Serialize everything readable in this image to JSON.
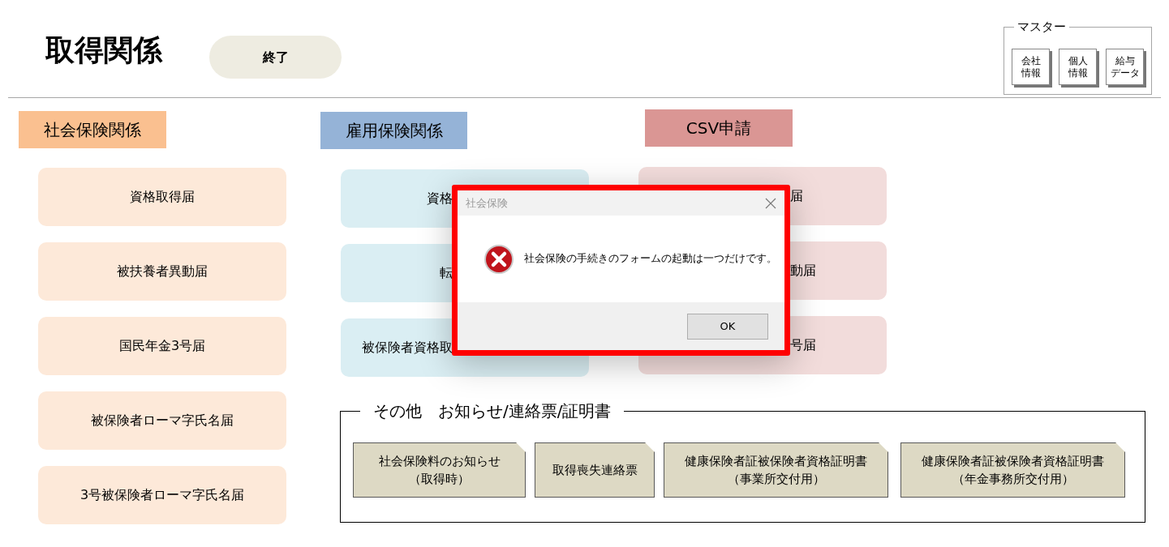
{
  "title": "取得関係",
  "exit_button": "終了",
  "master": {
    "label": "マスター",
    "buttons": [
      [
        "会社",
        "情報"
      ],
      [
        "個人",
        "情報"
      ],
      [
        "給与",
        "データ"
      ]
    ]
  },
  "sections": [
    {
      "title": "社会保険関係",
      "color": "#fac090",
      "kind": "social",
      "items": [
        "資格取得届",
        "被扶養者異動届",
        "国民年金3号届",
        "被保険者ローマ字氏名届",
        "3号被保険者ローマ字氏名届"
      ]
    },
    {
      "title": "雇用保険関係",
      "color": "#95b3d7",
      "kind": "employment",
      "items": [
        "資格",
        "転",
        "被保険者資格取"
      ]
    },
    {
      "title": "CSV申請",
      "color": "#da9694",
      "kind": "csv",
      "items": [
        "届",
        "動届",
        "号届"
      ]
    }
  ],
  "other": {
    "legend": "その他　お知らせ/連絡票/証明書",
    "buttons": [
      [
        "社会保険料のお知らせ",
        "（取得時）"
      ],
      [
        "取得喪失連絡票"
      ],
      [
        "健康保険者証被保険者資格証明書",
        "（事業所交付用）"
      ],
      [
        "健康保険者証被保険者資格証明書",
        "（年金事務所交付用）"
      ]
    ]
  },
  "dialog": {
    "title": "社会保険",
    "message": "社会保険の手続きのフォームの起動は一つだけです。",
    "ok": "OK"
  }
}
